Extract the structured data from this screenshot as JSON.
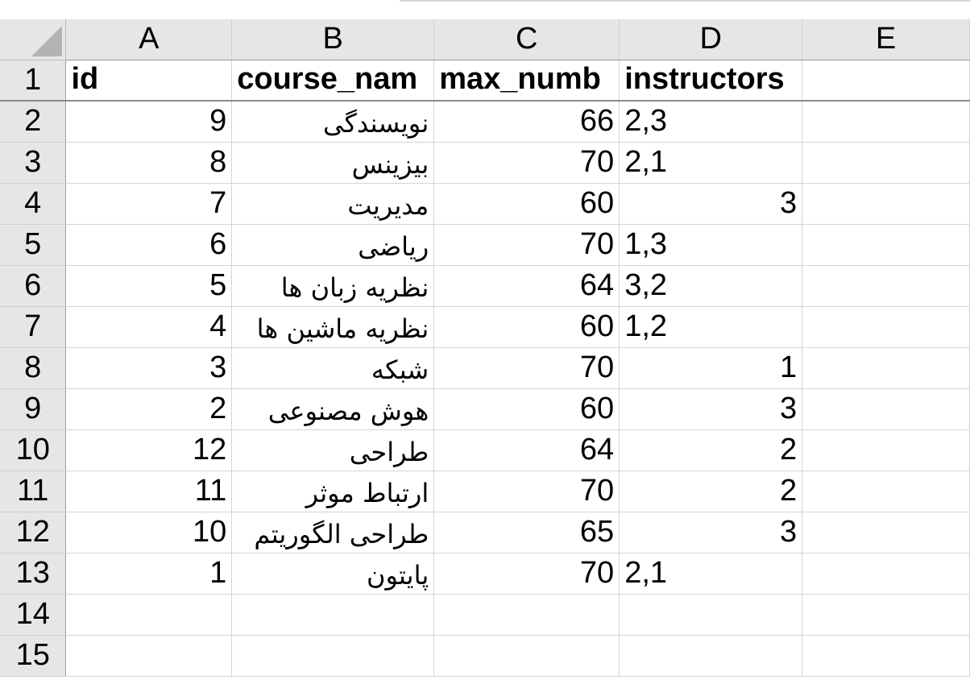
{
  "columns": [
    "A",
    "B",
    "C",
    "D",
    "E"
  ],
  "row_numbers": [
    "1",
    "2",
    "3",
    "4",
    "5",
    "6",
    "7",
    "8",
    "9",
    "10",
    "11",
    "12",
    "13",
    "14",
    "15"
  ],
  "header_row": {
    "id": "id",
    "course_name": "course_nam",
    "max_number": "max_numb",
    "instructors": "instructors"
  },
  "rows": [
    {
      "id": "9",
      "course_name": "نویسندگی",
      "max_number": "66",
      "instructors": "2,3",
      "instructors_align": "left"
    },
    {
      "id": "8",
      "course_name": "بیزینس",
      "max_number": "70",
      "instructors": "2,1",
      "instructors_align": "left"
    },
    {
      "id": "7",
      "course_name": "مدیریت",
      "max_number": "60",
      "instructors": "3",
      "instructors_align": "right"
    },
    {
      "id": "6",
      "course_name": "ریاضی",
      "max_number": "70",
      "instructors": "1,3",
      "instructors_align": "left"
    },
    {
      "id": "5",
      "course_name": "نظریه زبان ها",
      "max_number": "64",
      "instructors": "3,2",
      "instructors_align": "left"
    },
    {
      "id": "4",
      "course_name": "نظریه ماشین ها",
      "max_number": "60",
      "instructors": "1,2",
      "instructors_align": "left"
    },
    {
      "id": "3",
      "course_name": "شبکه",
      "max_number": "70",
      "instructors": "1",
      "instructors_align": "right"
    },
    {
      "id": "2",
      "course_name": "هوش مصنوعی",
      "max_number": "60",
      "instructors": "3",
      "instructors_align": "right"
    },
    {
      "id": "12",
      "course_name": "طراحی",
      "max_number": "64",
      "instructors": "2",
      "instructors_align": "right"
    },
    {
      "id": "11",
      "course_name": "ارتباط موثر",
      "max_number": "70",
      "instructors": "2",
      "instructors_align": "right"
    },
    {
      "id": "10",
      "course_name": "طراحی الگوریتم",
      "max_number": "65",
      "instructors": "3",
      "instructors_align": "right"
    },
    {
      "id": "1",
      "course_name": "پایتون",
      "max_number": "70",
      "instructors": "2,1",
      "instructors_align": "left"
    }
  ]
}
